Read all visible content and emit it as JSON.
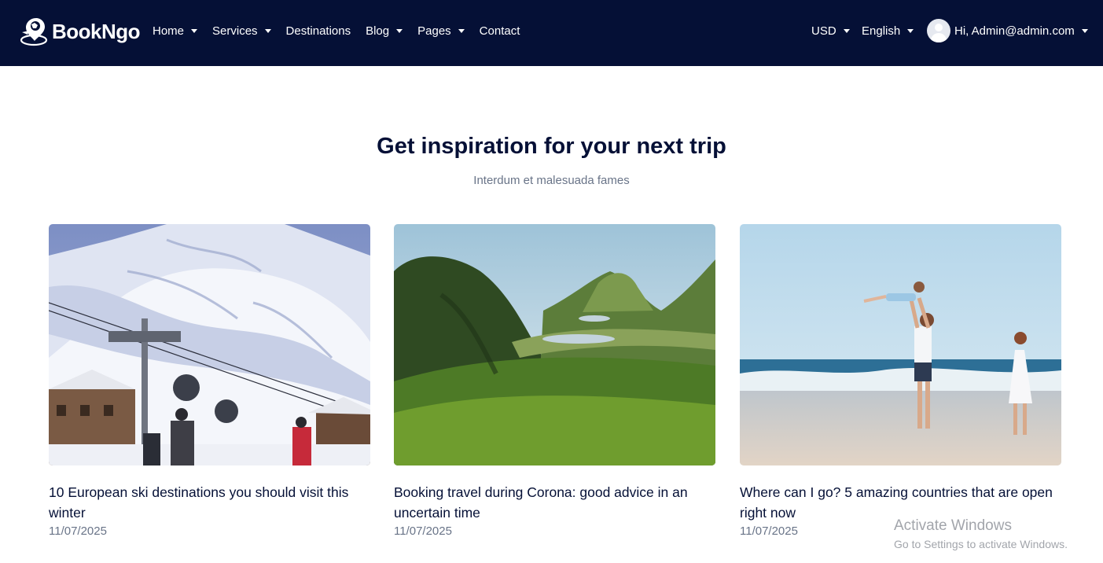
{
  "header": {
    "brand": "BookNgo",
    "nav": [
      {
        "label": "Home",
        "has_dropdown": true
      },
      {
        "label": "Services",
        "has_dropdown": true
      },
      {
        "label": "Destinations",
        "has_dropdown": false
      },
      {
        "label": "Blog",
        "has_dropdown": true
      },
      {
        "label": "Pages",
        "has_dropdown": true
      },
      {
        "label": "Contact",
        "has_dropdown": false
      }
    ],
    "currency": "USD",
    "language": "English",
    "user_greeting": "Hi, Admin@admin.com",
    "colors": {
      "background": "#051036",
      "text": "#ffffff"
    }
  },
  "section": {
    "title": "Get inspiration for your next trip",
    "subtitle": "Interdum et malesuada fames"
  },
  "posts": [
    {
      "title": "10 European ski destinations you should visit this winter",
      "date": "11/07/2025",
      "image": "snowy-ski-resort-with-cable-cars"
    },
    {
      "title": "Booking travel during Corona: good advice in an uncertain time",
      "date": "11/07/2025",
      "image": "green-mountain-valley-with-lake"
    },
    {
      "title": "Where can I go? 5 amazing countries that are open right now",
      "date": "11/07/2025",
      "image": "family-playing-on-beach"
    }
  ],
  "watermark": {
    "line1": "Activate Windows",
    "line2": "Go to Settings to activate Windows."
  }
}
